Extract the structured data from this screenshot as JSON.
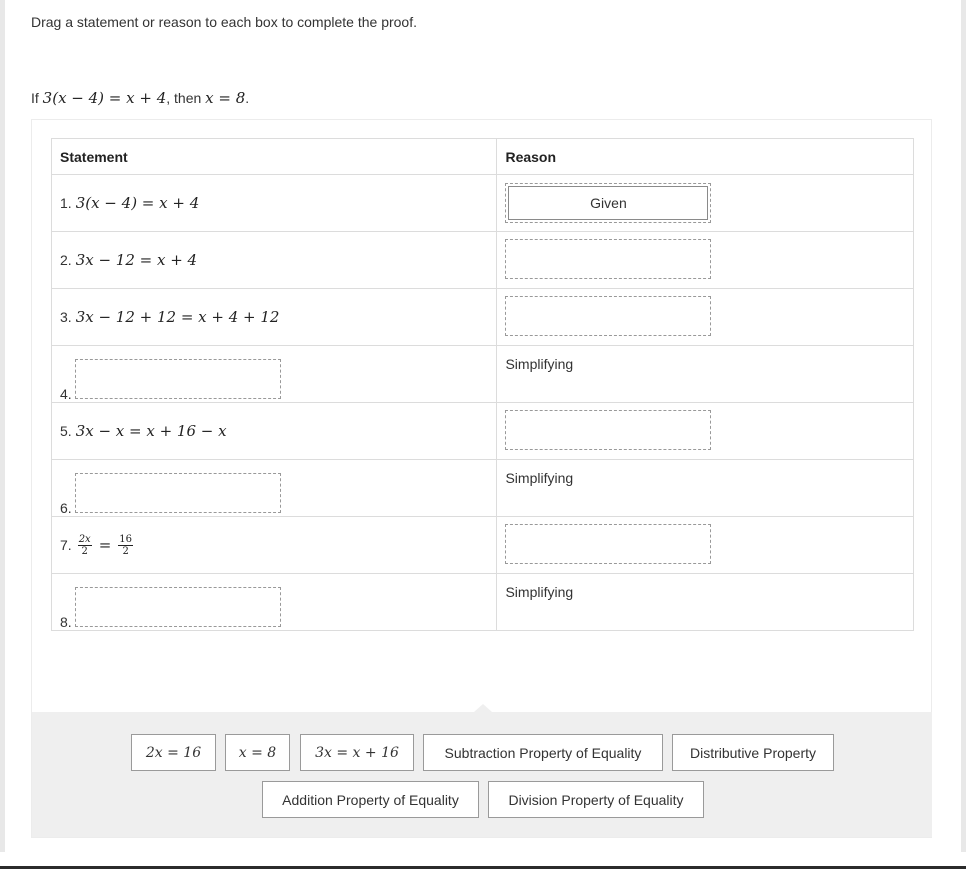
{
  "instructions": "Drag a statement or reason to each box to complete the proof.",
  "problem": {
    "prefix": "If",
    "given": "3(x − 4) = x + 4",
    "middle": ", then",
    "conclusion": "x = 8",
    "suffix": "."
  },
  "table": {
    "headers": {
      "statement": "Statement",
      "reason": "Reason"
    },
    "rows": [
      {
        "num": "1.",
        "statement": "3(x − 4) = x + 4",
        "reason": "Given",
        "reason_type": "filled-box"
      },
      {
        "num": "2.",
        "statement": "3x − 12 = x + 4",
        "reason": "",
        "reason_type": "empty-box"
      },
      {
        "num": "3.",
        "statement": "3x − 12 + 12 = x + 4 + 12",
        "reason": "",
        "reason_type": "empty-box"
      },
      {
        "num": "4.",
        "statement": "",
        "reason": "Simplifying",
        "reason_type": "text"
      },
      {
        "num": "5.",
        "statement": "3x − x = x + 16 − x",
        "reason": "",
        "reason_type": "empty-box"
      },
      {
        "num": "6.",
        "statement": "",
        "reason": "Simplifying",
        "reason_type": "text"
      },
      {
        "num": "7.",
        "statement_fraction": {
          "left_num": "2x",
          "left_den": "2",
          "eq": "=",
          "right_num": "16",
          "right_den": "2"
        },
        "reason": "",
        "reason_type": "empty-box"
      },
      {
        "num": "8.",
        "statement": "",
        "reason": "Simplifying",
        "reason_type": "text"
      }
    ]
  },
  "bank": {
    "tiles": [
      "2x = 16",
      "x = 8",
      "3x = x + 16",
      "Subtraction Property of Equality",
      "Distributive Property",
      "Addition Property of Equality",
      "Division Property of Equality"
    ]
  }
}
